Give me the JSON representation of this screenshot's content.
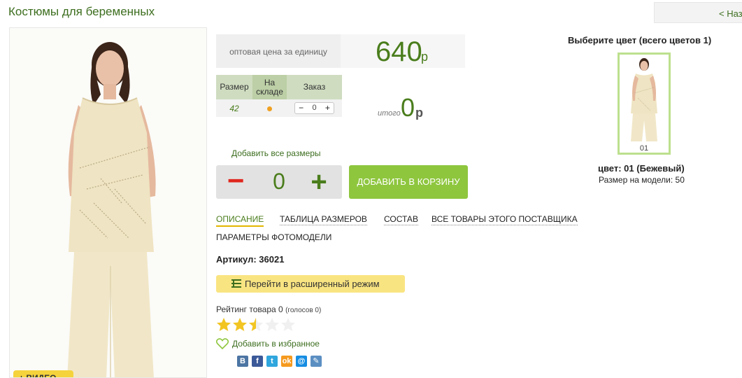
{
  "page": {
    "title": "Костюмы для беременных",
    "back_label": "< Назад"
  },
  "photo": {
    "badge_label": "+ ВИДЕО"
  },
  "price": {
    "label": "оптовая цена за единицу",
    "value": "640",
    "currency": "р"
  },
  "size_table": {
    "headers": [
      "Размер",
      "На складе",
      "Заказ"
    ],
    "rows": [
      {
        "size": "42",
        "stock": "available",
        "order_qty": "0"
      }
    ],
    "minus": "−",
    "plus": "+"
  },
  "total": {
    "label": "итого",
    "value": "0",
    "currency": "р"
  },
  "add_all_sizes": "Добавить все размеры",
  "stepper": {
    "minus": "−",
    "value": "0",
    "plus": "+"
  },
  "cart_button": "ДОБАВИТЬ В КОРЗИНУ",
  "tabs": [
    {
      "label": "ОПИСАНИЕ",
      "active": true
    },
    {
      "label": "ТАБЛИЦА РАЗМЕРОВ",
      "active": false
    },
    {
      "label": "СОСТАВ",
      "active": false
    },
    {
      "label": "ВСЕ ТОВАРЫ ЭТОГО ПОСТАВЩИКА",
      "active": false
    },
    {
      "label": "ПАРАМЕТРЫ ФОТОМОДЕЛИ",
      "active": false
    }
  ],
  "article": {
    "label": "Артикул:",
    "value": "36021"
  },
  "advanced_button": "Перейти в расширенный режим",
  "rating": {
    "label": "Рейтинг товара",
    "value": "0",
    "votes": "(голосов 0)",
    "stars_filled": 2.5,
    "stars_total": 5
  },
  "favorite": "Добавить в избранное",
  "social": [
    {
      "name": "vk-icon",
      "glyph": "В",
      "color": "#4c75a3"
    },
    {
      "name": "facebook-icon",
      "glyph": "f",
      "color": "#3b5998"
    },
    {
      "name": "twitter-icon",
      "glyph": "t",
      "color": "#2fa6dd"
    },
    {
      "name": "odnoklassniki-icon",
      "glyph": "ok",
      "color": "#f59a1f"
    },
    {
      "name": "mail-ru-icon",
      "glyph": "@",
      "color": "#168de2"
    },
    {
      "name": "livejournal-icon",
      "glyph": "✎",
      "color": "#5b8fc2"
    }
  ],
  "colors": {
    "title": "Выберите цвет (всего цветов 1)",
    "thumb_code": "01",
    "selected_name": "цвет: 01 (Бежевый)",
    "model_size": "Размер на модели: 50"
  },
  "theme": {
    "green": "#4a7d1c",
    "cart_green": "#8ec63e",
    "accent_yellow": "#f9e482",
    "thumb_border": "#bde08e"
  }
}
